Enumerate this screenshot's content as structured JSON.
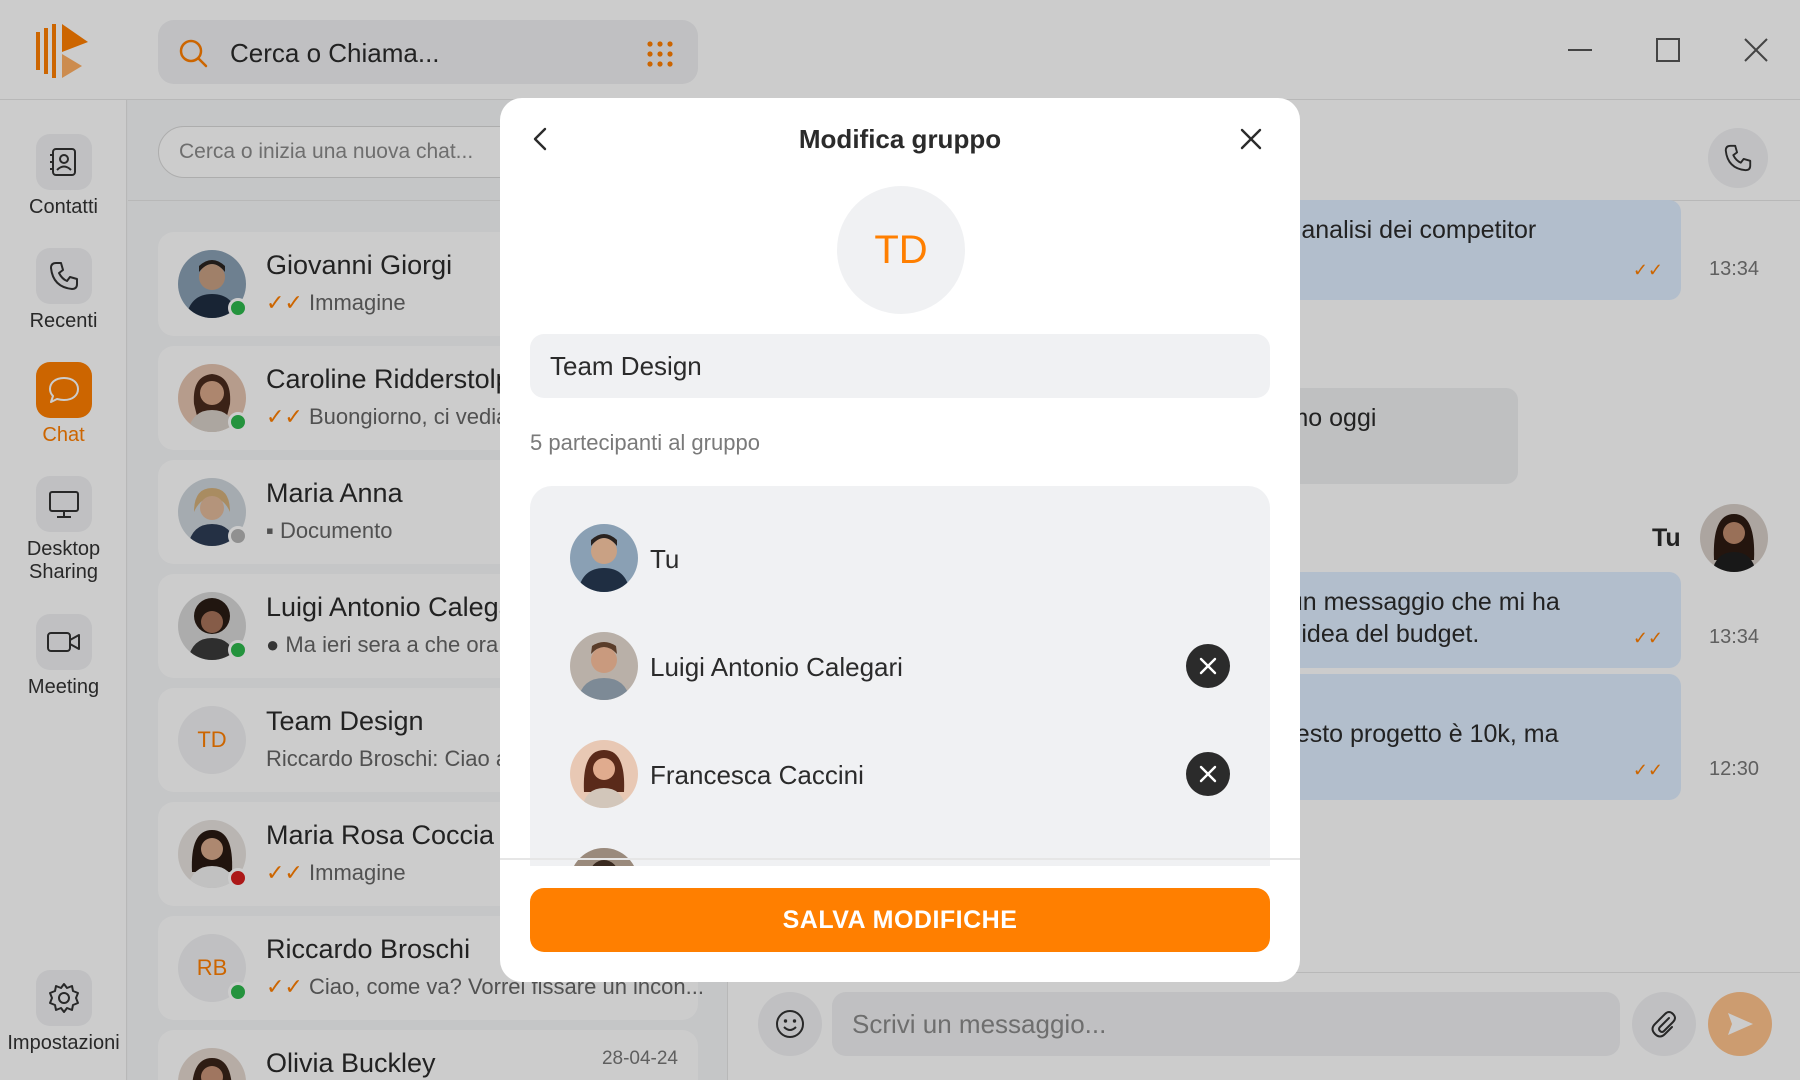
{
  "topbar": {
    "search_placeholder": "Cerca o Chiama..."
  },
  "rail": {
    "items": [
      {
        "label": "Contatti",
        "icon": "contacts-icon"
      },
      {
        "label": "Recenti",
        "icon": "phone-icon"
      },
      {
        "label": "Chat",
        "icon": "chat-bubble-icon",
        "active": true
      },
      {
        "label_line1": "Desktop",
        "label_line2": "Sharing",
        "icon": "monitor-icon"
      },
      {
        "label": "Meeting",
        "icon": "video-camera-icon"
      }
    ],
    "settings_label": "Impostazioni"
  },
  "chatlist": {
    "search_placeholder": "Cerca o inizia una nuova chat...",
    "items": [
      {
        "name": "Giovanni Giorgi",
        "preview": "Immagine",
        "status": "online"
      },
      {
        "name": "Caroline Ridderstolpe",
        "preview": "Buongiorno, ci vediamo",
        "status": "online"
      },
      {
        "name": "Maria Anna",
        "preview": "Documento",
        "status": "offline"
      },
      {
        "name": "Luigi Antonio Calegari",
        "preview": "Ma ieri sera a che ora",
        "status": "online"
      },
      {
        "name": "Team Design",
        "initials": "TD",
        "preview": "Riccardo Broschi: Ciao a"
      },
      {
        "name": "Maria Rosa Coccia",
        "preview": "Immagine",
        "status": "busy"
      },
      {
        "name": "Riccardo Broschi",
        "initials": "RB",
        "preview": "Ciao, come va? Vorrei fissare un incon...",
        "status": "online"
      },
      {
        "name": "Olivia Buckley",
        "date": "28-04-24"
      }
    ]
  },
  "conversation": {
    "messages": [
      {
        "text": "un’analisi dei competitor",
        "time": "13:34"
      },
      {
        "text": "iamo oggi"
      },
      {
        "sender": "Tu"
      },
      {
        "line1": "e un messaggio che mi ha",
        "line2": "un’idea del budget.",
        "time": "13:34"
      },
      {
        "text": "questo progetto è 10k, ma",
        "time": "12:30"
      }
    ],
    "input_placeholder": "Scrivi un messaggio..."
  },
  "modal": {
    "title": "Modifica gruppo",
    "group_initials": "TD",
    "group_name": "Team Design",
    "participants_count": "5 partecipanti al gruppo",
    "participants": [
      {
        "name": "Tu"
      },
      {
        "name": "Luigi Antonio Calegari"
      },
      {
        "name": "Francesca Caccini"
      }
    ],
    "save_label": "SALVA MODIFICHE"
  },
  "colors": {
    "accent": "#ff7f00",
    "online": "#2db84d",
    "offline": "#b5b5b5",
    "busy": "#d81e1e",
    "outgoing_bubble": "#dfeeff"
  }
}
